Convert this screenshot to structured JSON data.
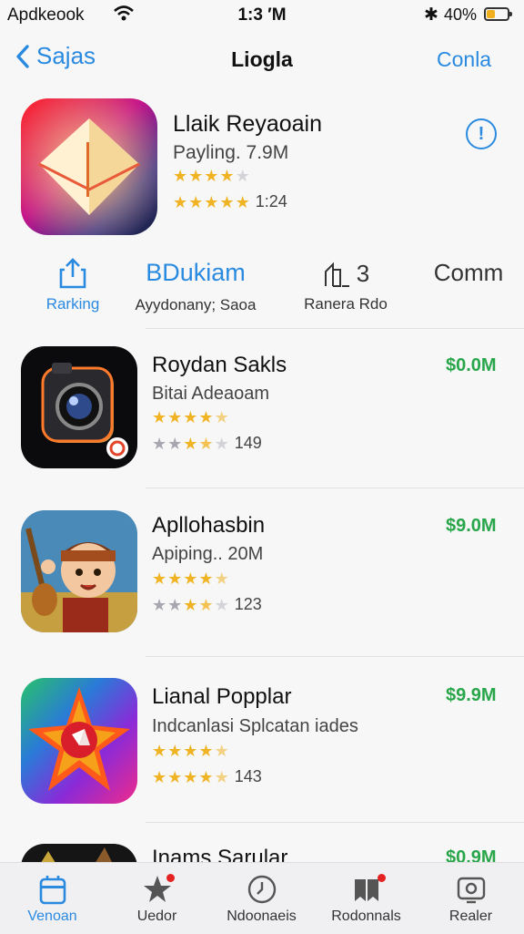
{
  "status": {
    "carrier": "Apdkeook",
    "time": "1:3 ′M",
    "battery_text": "40%",
    "battery_level": 0.4,
    "wifi_icon": "wifi-icon",
    "bluetooth_icon": "bluetooth-icon"
  },
  "nav": {
    "back_label": "Sajas",
    "title": "Liogla",
    "right_label": "Conla"
  },
  "featured": {
    "name": "Llaik Reyaoain",
    "subtitle": "Payling. 7.9M",
    "rating_primary": 4.0,
    "rating_secondary": 5.0,
    "rating_count": "1:24",
    "info_icon": "info-icon"
  },
  "actions": [
    {
      "icon": "share-icon",
      "label": "Rarking",
      "name": "ranking"
    },
    {
      "icon": "",
      "label": "Ayydonany; Saoa",
      "big": "BDukiam",
      "name": "bdukiam"
    },
    {
      "icon": "chart-icon",
      "label": "Ranera Rdo",
      "big": "3",
      "name": "ranera"
    },
    {
      "icon": "",
      "label": "",
      "big": "Comm",
      "name": "comm"
    }
  ],
  "list": [
    {
      "name": "Roydan Sakls",
      "subtitle": "Bitai Adeaoam",
      "price": "$0.0M",
      "rating_a": 4.5,
      "rating_b": 4.0,
      "count": "149",
      "icon": "camera-icon"
    },
    {
      "name": "Apllohasbin",
      "subtitle": "Apiping.. 20M",
      "price": "$9.0M",
      "rating_a": 4.5,
      "rating_b": 4.0,
      "count": "123",
      "icon": "character-icon"
    },
    {
      "name": "Lianal Popplar",
      "subtitle": "Indcanlasi Splcatan iades",
      "price": "$9.9M",
      "rating_a": 4.5,
      "rating_b": 4.5,
      "count": "143",
      "icon": "compass-star-icon"
    },
    {
      "name": "Inams Sarular",
      "subtitle": "",
      "price": "$0.9M",
      "rating_a": 0,
      "rating_b": 0,
      "count": "",
      "icon": "partial-icon"
    }
  ],
  "tabs": [
    {
      "label": "Venoan",
      "icon": "today-icon",
      "active": true
    },
    {
      "label": "Uedor",
      "icon": "star-tab-icon",
      "badge": true
    },
    {
      "label": "Ndoonaeis",
      "icon": "clock-icon"
    },
    {
      "label": "Rodonnals",
      "icon": "bookmark-icon",
      "badge": true
    },
    {
      "label": "Realer",
      "icon": "search-tab-icon"
    }
  ],
  "colors": {
    "accent": "#2a8ae0",
    "price": "#2aa64a",
    "star": "#f0b323"
  }
}
